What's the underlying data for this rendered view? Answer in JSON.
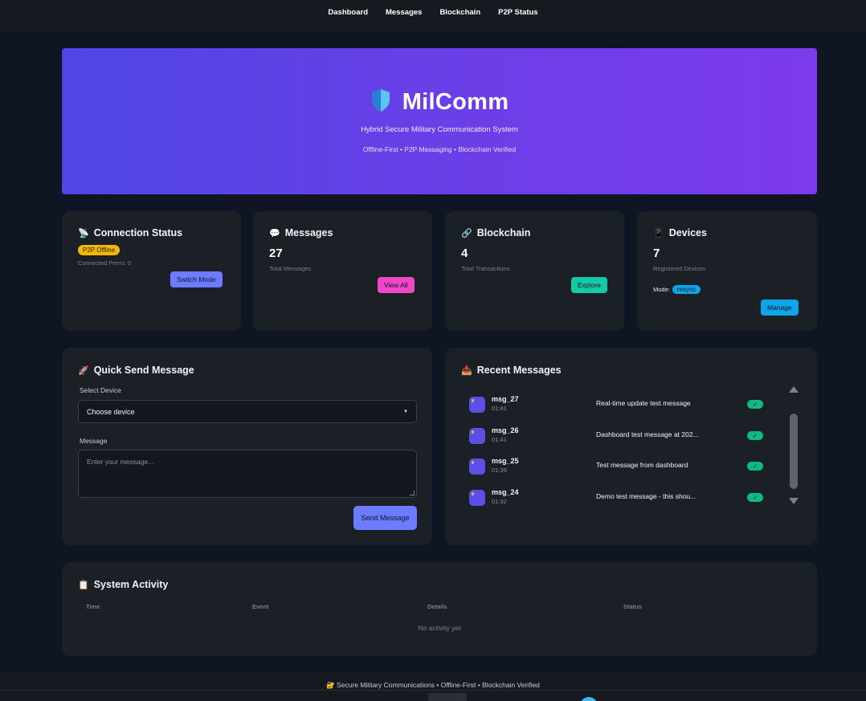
{
  "nav": {
    "items": [
      "Dashboard",
      "Messages",
      "Blockchain",
      "P2P Status"
    ]
  },
  "hero": {
    "icon": "shield-icon",
    "title": "MilComm",
    "subtitle": "Hybrid Secure Military Communication System",
    "tagline": "Offline-First • P2P Messaging • Blockchain Verified",
    "gradient": [
      "#4f46e5",
      "#7c3aed"
    ]
  },
  "cards": {
    "connection": {
      "icon": "satellite-icon",
      "title": "Connection Status",
      "badge": "P2P Offline",
      "badge_color": "#f5b700",
      "peers": "Connected Peers: 0",
      "button": "Switch Mode",
      "button_color": "#6c7bff"
    },
    "messages": {
      "icon": "speech-bubble-icon",
      "title": "Messages",
      "count": "27",
      "label": "Total Messages",
      "button": "View All",
      "button_color": "#f046c8"
    },
    "blockchain": {
      "icon": "link-icon",
      "title": "Blockchain",
      "count": "4",
      "label": "Total Transactions",
      "button": "Explore",
      "button_color": "#14c9a4"
    },
    "devices": {
      "icon": "device-icon",
      "title": "Devices",
      "count": "7",
      "label": "Registered Devices",
      "mode_label": "Mode:",
      "mode_value": "resync",
      "button": "Manage",
      "button_color": "#0ea5e9"
    }
  },
  "quick_send": {
    "icon": "rocket-icon",
    "title": "Quick Send Message",
    "device_label": "Select Device",
    "device_value": "Choose device",
    "message_label": "Message",
    "message_placeholder": "Enter your message...",
    "button": "Send Message",
    "button_color": "#6c7bff"
  },
  "recent": {
    "icon": "inbox-icon",
    "title": "Recent Messages",
    "check_mark": "✓",
    "items": [
      {
        "id": "msg_27",
        "time": "01:41",
        "text": "Real-time update test message"
      },
      {
        "id": "msg_26",
        "time": "01:41",
        "text": "Dashboard test message at 202..."
      },
      {
        "id": "msg_25",
        "time": "01:39",
        "text": "Test message from dashboard"
      },
      {
        "id": "msg_24",
        "time": "01:32",
        "text": "Demo test message - this shou..."
      }
    ]
  },
  "activity": {
    "icon": "clipboard-icon",
    "title": "System Activity",
    "columns": [
      "Time",
      "Event",
      "Details",
      "Status"
    ],
    "empty": "No activity yet"
  },
  "footer": {
    "icon": "lock-icon",
    "text": "Secure Military Communications • Offline-First • Blockchain Verified"
  }
}
